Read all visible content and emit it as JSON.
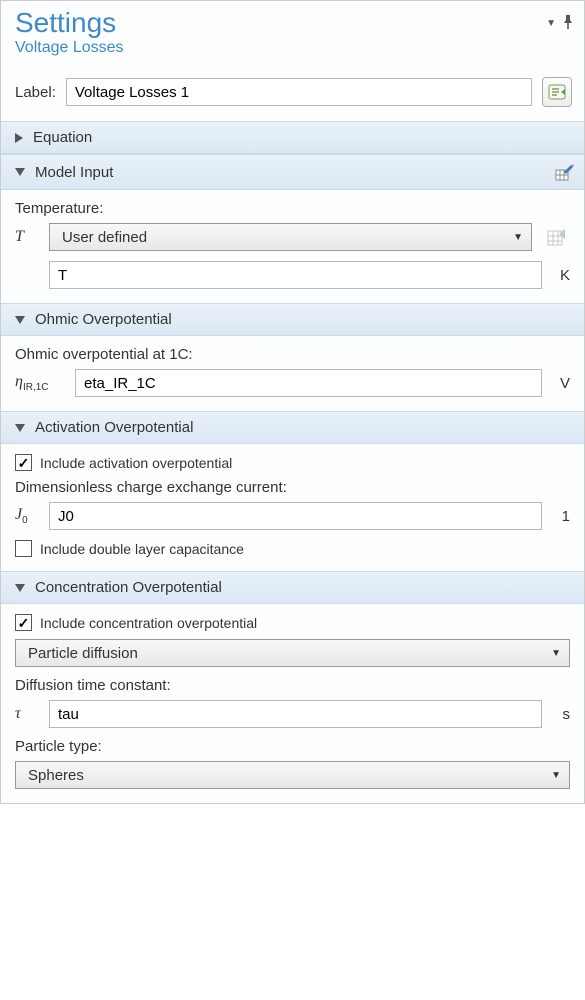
{
  "header": {
    "title": "Settings",
    "subtitle": "Voltage Losses"
  },
  "label": {
    "text": "Label:",
    "value": "Voltage Losses 1"
  },
  "sections": {
    "equation": {
      "title": "Equation"
    },
    "model_input": {
      "title": "Model Input",
      "temperature_label": "Temperature:",
      "temperature_symbol": "T",
      "temperature_select": "User defined",
      "temperature_value": "T",
      "temperature_unit": "K"
    },
    "ohmic": {
      "title": "Ohmic Overpotential",
      "field_label": "Ohmic overpotential at 1C:",
      "symbol": "ηIR,1C",
      "value": "eta_IR_1C",
      "unit": "V"
    },
    "activation": {
      "title": "Activation Overpotential",
      "include_label": "Include activation overpotential",
      "include_checked": true,
      "dimless_label": "Dimensionless charge exchange current:",
      "J0_symbol": "J0",
      "J0_value": "J0",
      "J0_unit": "1",
      "dbl_layer_label": "Include double layer capacitance",
      "dbl_layer_checked": false
    },
    "concentration": {
      "title": "Concentration Overpotential",
      "include_label": "Include concentration overpotential",
      "include_checked": true,
      "mode_select": "Particle diffusion",
      "tau_label": "Diffusion time constant:",
      "tau_symbol": "τ",
      "tau_value": "tau",
      "tau_unit": "s",
      "ptype_label": "Particle type:",
      "ptype_select": "Spheres"
    }
  }
}
